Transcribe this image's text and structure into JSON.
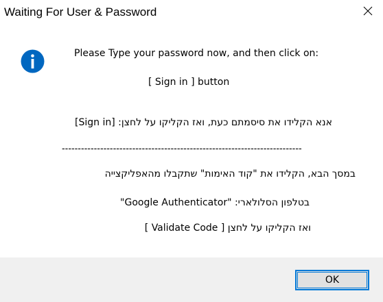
{
  "window": {
    "title": "Waiting For User & Password"
  },
  "message": {
    "line1": "Please Type your password now, and then click on:",
    "line2": "[ Sign in ] button",
    "line3": "אנא הקלידו את סיסמתם כעת, ואז הקליקו על לחצן:  [Sign in]",
    "separator": "---------------------------------------------------------------------------",
    "line5": "במסך הבא, הקלידו את \"קוד האימות\" שתקבלו מהאפליקצייה",
    "line6": "בטלפון הסלולארי: \"Google Authenticator\"",
    "line7": "ואז הקליקו על לחצן  [ Validate Code ]"
  },
  "footer": {
    "ok_label": "OK"
  },
  "icons": {
    "info": "info-icon",
    "close": "close-icon"
  },
  "colors": {
    "info_blue": "#0067c0",
    "button_border": "#0078d7",
    "footer_bg": "#f0f0f0",
    "button_bg": "#e1e1e1"
  }
}
